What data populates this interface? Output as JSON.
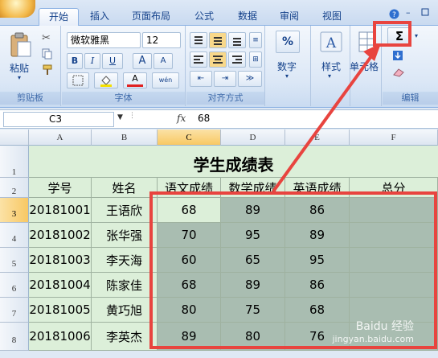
{
  "tabs": [
    "开始",
    "插入",
    "页面布局",
    "公式",
    "数据",
    "审阅",
    "视图"
  ],
  "ribbon": {
    "clipboard": {
      "label": "剪贴板",
      "paste": "粘贴"
    },
    "font": {
      "label": "字体",
      "name": "微软雅黑",
      "size": "12",
      "bold": "B",
      "italic": "I",
      "underline": "U",
      "grow": "A",
      "shrink": "A",
      "font_color_letter": "A",
      "phonetic": "wén"
    },
    "alignment": {
      "label": "对齐方式"
    },
    "number": {
      "label": "数字",
      "symbol": "%"
    },
    "styles": {
      "label": "样式"
    },
    "cells": {
      "label": "单元格"
    },
    "editing": {
      "label": "编辑",
      "sum": "Σ"
    }
  },
  "formula_bar": {
    "name_box": "C3",
    "fx": "fx",
    "value": "68"
  },
  "columns": [
    "A",
    "B",
    "C",
    "D",
    "E",
    "F"
  ],
  "rows": [
    "1",
    "2",
    "3",
    "4",
    "5",
    "6",
    "7",
    "8"
  ],
  "title": "学生成绩表",
  "headers": [
    "学号",
    "姓名",
    "语文成绩",
    "数学成绩",
    "英语成绩",
    "总分"
  ],
  "data": [
    {
      "id": "20181001",
      "name": "王语欣",
      "chinese": "68",
      "math": "89",
      "english": "86",
      "total": ""
    },
    {
      "id": "20181002",
      "name": "张华强",
      "chinese": "70",
      "math": "95",
      "english": "89",
      "total": ""
    },
    {
      "id": "20181003",
      "name": "李天海",
      "chinese": "60",
      "math": "65",
      "english": "95",
      "total": ""
    },
    {
      "id": "20181004",
      "name": "陈家佳",
      "chinese": "68",
      "math": "89",
      "english": "86",
      "total": ""
    },
    {
      "id": "20181005",
      "name": "黄巧旭",
      "chinese": "80",
      "math": "75",
      "english": "68",
      "total": ""
    },
    {
      "id": "20181006",
      "name": "李英杰",
      "chinese": "89",
      "math": "80",
      "english": "76",
      "total": ""
    }
  ],
  "watermark": {
    "line1": "Baidu 经验",
    "line2": "jingyan.baidu.com"
  },
  "colors": {
    "annotation": "#e8443f",
    "selected_range": "#a9bdb1",
    "sheet_fill": "#dcefd9"
  }
}
